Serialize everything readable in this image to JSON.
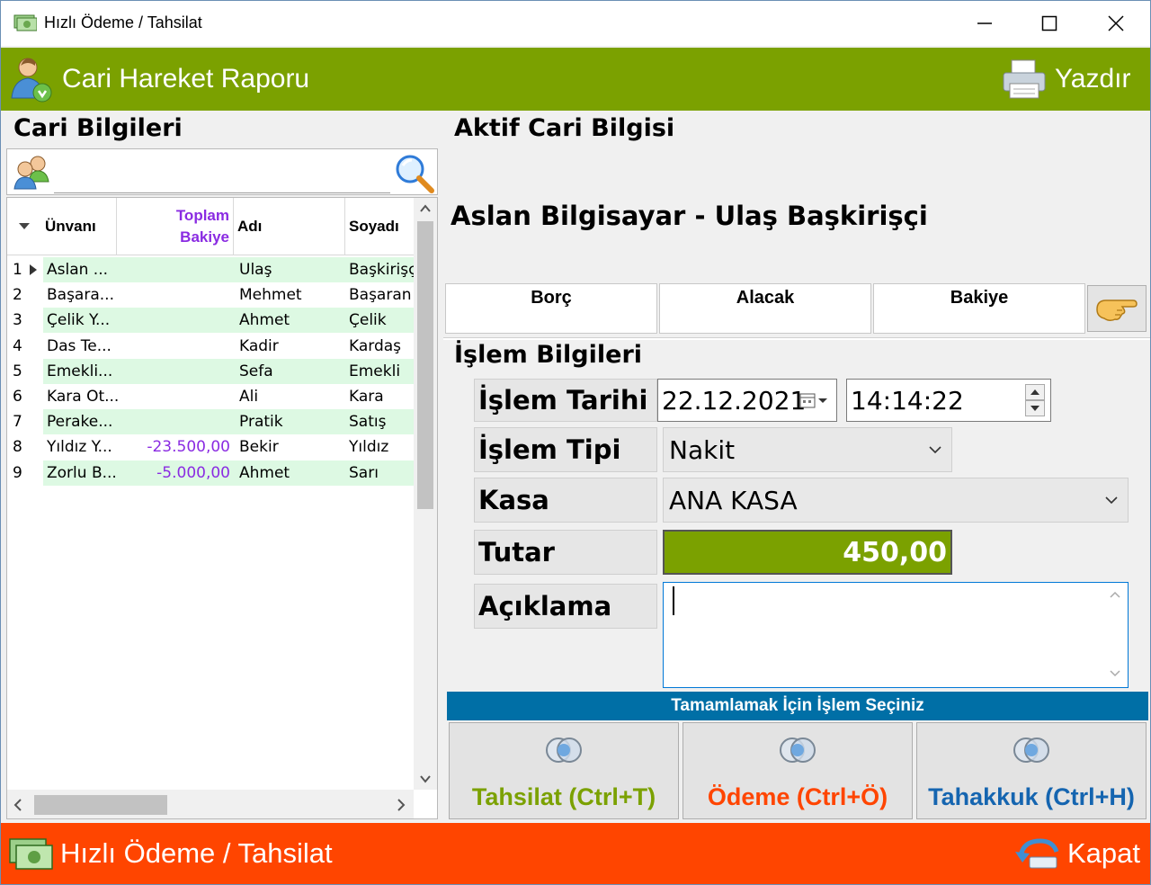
{
  "window": {
    "title": "Hızlı Ödeme / Tahsilat",
    "controls": [
      "minimize",
      "maximize",
      "close"
    ]
  },
  "header": {
    "title": "Cari Hareket Raporu",
    "print_label": "Yazdır",
    "color": "#7ba100"
  },
  "left": {
    "section_title": "Cari Bilgileri",
    "search_value": "",
    "columns": {
      "unvan": "Ünvanı",
      "bakiye_line1": "Toplam",
      "bakiye_line2": "Bakiye",
      "adi": "Adı",
      "soyadi": "Soyadı"
    },
    "rows": [
      {
        "no": "1",
        "unvan": "Aslan ...",
        "bakiye": "",
        "adi": "Ulaş",
        "soyadi": "Başkirişçi",
        "current": true
      },
      {
        "no": "2",
        "unvan": "Başara...",
        "bakiye": "",
        "adi": "Mehmet",
        "soyadi": "Başaran"
      },
      {
        "no": "3",
        "unvan": "Çelik Y...",
        "bakiye": "",
        "adi": "Ahmet",
        "soyadi": "Çelik"
      },
      {
        "no": "4",
        "unvan": "Das Te...",
        "bakiye": "",
        "adi": "Kadir",
        "soyadi": "Kardaş"
      },
      {
        "no": "5",
        "unvan": "Emekli...",
        "bakiye": "",
        "adi": "Sefa",
        "soyadi": "Emekli"
      },
      {
        "no": "6",
        "unvan": "Kara Ot...",
        "bakiye": "",
        "adi": "Ali",
        "soyadi": "Kara"
      },
      {
        "no": "7",
        "unvan": "Perake...",
        "bakiye": "",
        "adi": "Pratik",
        "soyadi": "Satış"
      },
      {
        "no": "8",
        "unvan": "Yıldız Y...",
        "bakiye": "-23.500,00",
        "adi": "Bekir",
        "soyadi": "Yıldız"
      },
      {
        "no": "9",
        "unvan": "Zorlu B...",
        "bakiye": "-5.000,00",
        "adi": "Ahmet",
        "soyadi": "Sarı"
      }
    ]
  },
  "right": {
    "section_title": "Aktif Cari Bilgisi",
    "cari_name": "Aslan Bilgisayar - Ulaş Başkirişçi",
    "totals": {
      "borc": "Borç",
      "alacak": "Alacak",
      "bakiye": "Bakiye"
    },
    "islem_title": "İşlem Bilgileri",
    "form": {
      "tarih_label": "İşlem Tarihi",
      "tarih_value": "22.12.2021",
      "saat_value": "14:14:22",
      "tip_label": "İşlem Tipi",
      "tip_value": "Nakit",
      "kasa_label": "Kasa",
      "kasa_value": "ANA KASA",
      "tutar_label": "Tutar",
      "tutar_value": "450,00",
      "aciklama_label": "Açıklama",
      "aciklama_value": ""
    },
    "select_prompt": "Tamamlamak İçin İşlem Seçiniz",
    "actions": {
      "tahsilat": "Tahsilat (Ctrl+T)",
      "odeme": "Ödeme (Ctrl+Ö)",
      "tahakkuk": "Tahakkuk (Ctrl+H)"
    }
  },
  "footer": {
    "title": "Hızlı Ödeme / Tahsilat",
    "close_label": "Kapat",
    "color": "#ff4500"
  }
}
